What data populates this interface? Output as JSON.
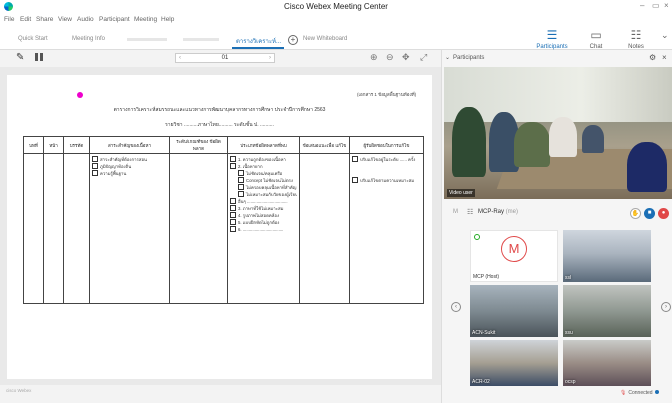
{
  "window": {
    "title": "Cisco Webex Meeting Center",
    "minimize": "–",
    "maximize": "▭",
    "close": "×"
  },
  "menu": [
    "File",
    "Edit",
    "Share",
    "View",
    "Audio",
    "Participant",
    "Meeting",
    "Help"
  ],
  "tabs": {
    "quick_start": "Quick Start",
    "meeting_info": "Meeting Info",
    "active": "ตารางวิเคราะห์...",
    "new_whiteboard": "New Whiteboard"
  },
  "top_buttons": {
    "participants": "Participants",
    "chat": "Chat",
    "notes": "Notes"
  },
  "toolbar": {
    "page": "01"
  },
  "document": {
    "header_right": "(เอกสาร 1 ข้อมูลพื้นฐานท้องที่)",
    "title": "ตารางการวิเคราะห์สมรรถนะและแนวทางการพัฒนาบุคลากรทางการศึกษา ประจำปีการศึกษา 2563",
    "subtitle": "รายวิชา ..........ภาษาไทย.......... ระดับชั้น ป. ..........",
    "columns": [
      "บทที่",
      "หน้า",
      "บรรทัด",
      "สาระสำคัญของเนื้อหา",
      "ระดับ/เกณฑ์ของ ข้อผิดพลาด",
      "ประเภทข้อผิดพลาดที่พบ",
      "ข้อเสนอแนะเพื่อ แก้ไข",
      "ผู้รับผิดชอบในการแก้ไข"
    ],
    "col4_items": [
      "สาระสำคัญที่ต้องการสอน",
      "ภูมิปัญญาท้องถิ่น",
      "ความรู้พื้นฐาน"
    ],
    "col6_items": [
      {
        "text": "1. ความถูกต้องของเนื้อหา",
        "sub": false
      },
      {
        "text": "2. เนื้อหายาก",
        "sub": false
      },
      {
        "text": "ไม่ชัดเจน/คลุมเครือ",
        "sub": true
      },
      {
        "text": "Concept ไม่ชัดเจนไม่ตรง",
        "sub": true
      },
      {
        "text": "ไม่ครอบคลุมเนื้อหาที่สำคัญ",
        "sub": true
      },
      {
        "text": "ไม่เหมาะสมกับวัยของผู้เรียน",
        "sub": true
      },
      {
        "text": "อื่นๆ ..................................",
        "sub": false
      },
      {
        "text": "3. ภาษาที่ใช้ไม่เหมาะสม",
        "sub": false
      },
      {
        "text": "4. รูปภาพไม่สอดคล้อง",
        "sub": false
      },
      {
        "text": "5. แบบฝึกหัดไม่ถูกต้อง",
        "sub": false
      },
      {
        "text": "6. ..................................",
        "sub": false
      }
    ],
    "col8_items": [
      "ปรับแก้ไขอยู่ในระดับ ...... ครั้ง",
      "ปรับแก้ไขตามความเหมาะสม"
    ]
  },
  "watermark": "cisco Webex",
  "panel": {
    "title": "Participants",
    "video_label": "Video user",
    "active_name": "MCP-Ray",
    "active_state": "(me)",
    "m_label": "M"
  },
  "thumbnails": [
    {
      "name": "MCP (Host)",
      "initial": "M"
    },
    {
      "name": "ssl",
      "initial": ""
    },
    {
      "name": "ACN-Sukit",
      "initial": ""
    },
    {
      "name": "ssu",
      "initial": ""
    },
    {
      "name": "ACR-02",
      "initial": ""
    },
    {
      "name": "ocsp",
      "initial": ""
    }
  ],
  "status": {
    "text": "Connected"
  },
  "colors": {
    "accent": "#1b6fb5",
    "pink_dot": "#ee00cc",
    "mute_red": "#e04848"
  }
}
